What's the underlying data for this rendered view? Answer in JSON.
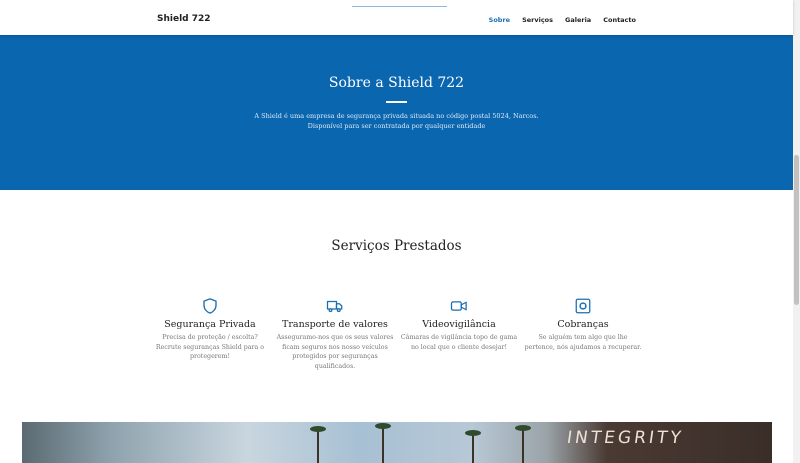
{
  "header": {
    "brand": "Shield 722",
    "nav": [
      "Sobre",
      "Serviços",
      "Galeria",
      "Contacto"
    ],
    "active_nav": "Sobre"
  },
  "hero": {
    "title": "Sobre a Shield 722",
    "text": "A Shield é uma empresa de segurança privada situada no código postal 5024, Narcos. Disponível para ser contratada por qualquer entidade"
  },
  "services": {
    "title": "Serviços Prestados",
    "items": [
      {
        "icon": "shield-icon",
        "title": "Segurança Privada",
        "text": "Precisa de proteção / escolta? Recrute seguranças Shield para o protegerem!"
      },
      {
        "icon": "truck-icon",
        "title": "Transporte de valores",
        "text": "Asseguramo-nos que os seus valores ficam seguros nos nosso veículos protegidos por seguranças qualificados."
      },
      {
        "icon": "video-camera-icon",
        "title": "Videovigilância",
        "text": "Câmaras de vigilância topo de gama no local que o cliente desejar!"
      },
      {
        "icon": "safe-icon",
        "title": "Cobranças",
        "text": "Se alguém tem algo que lhe pertence, nós ajudamos a recuperar."
      }
    ]
  },
  "gallery": {
    "sign_text": "INTEGRITY"
  },
  "colors": {
    "accent": "#0b66b0",
    "active_link": "#1a6fb3",
    "icon": "#1a6fb3"
  }
}
